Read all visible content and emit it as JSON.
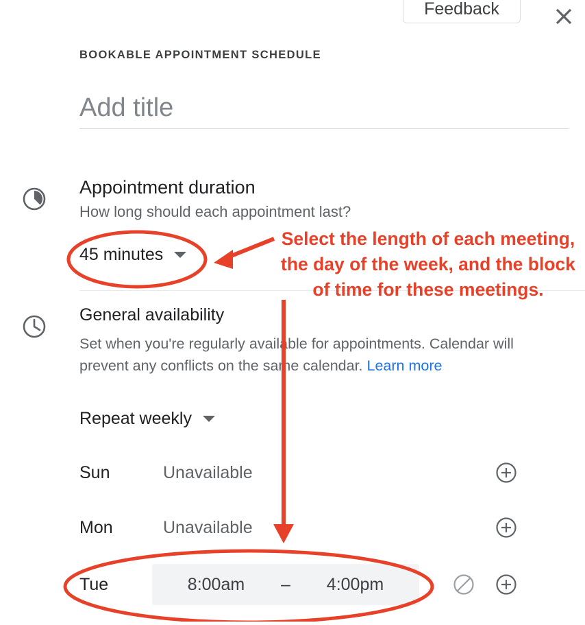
{
  "topbar": {
    "feedback_label": "Feedback",
    "close_icon": "close-icon"
  },
  "header": {
    "eyebrow": "BOOKABLE APPOINTMENT SCHEDULE",
    "title_value": "",
    "title_placeholder": "Add title"
  },
  "duration": {
    "icon": "appointment-duration-icon",
    "heading": "Appointment duration",
    "subtext": "How long should each appointment last?",
    "selected": "45 minutes",
    "caret_icon": "chevron-down-icon"
  },
  "availability": {
    "icon": "clock-icon",
    "heading": "General availability",
    "description": "Set when you're regularly available for appointments. Calendar will prevent any conflicts on the same calendar. ",
    "learn_more": "Learn more",
    "repeat_selected": "Repeat weekly",
    "repeat_caret_icon": "chevron-down-icon",
    "days": [
      {
        "label": "Sun",
        "status": "Unavailable",
        "has_time": false,
        "add_icon": "plus-circle-icon"
      },
      {
        "label": "Mon",
        "status": "Unavailable",
        "has_time": false,
        "add_icon": "plus-circle-icon"
      },
      {
        "label": "Tue",
        "status": "",
        "has_time": true,
        "start_time": "8:00am",
        "dash": "–",
        "end_time": "4:00pm",
        "block_icon": "no-entry-icon",
        "add_icon": "plus-circle-icon"
      }
    ]
  },
  "annotation": {
    "text": "Select the length of each meeting, the day of the week, and the block of time for these meetings.",
    "color": "#e8412a"
  },
  "colors": {
    "accent_red": "#e8412a",
    "link_blue": "#1a73e8",
    "text_primary": "#202124",
    "text_secondary": "#5f6368",
    "chip_bg": "#f1f3f4",
    "divider": "#e8eaed"
  }
}
